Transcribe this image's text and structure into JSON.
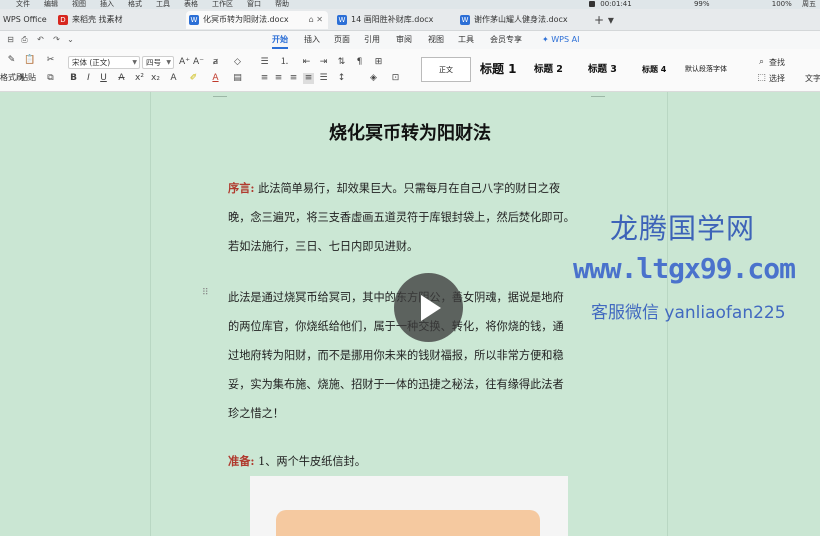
{
  "menubar": {
    "items": [
      "文件",
      "编辑",
      "视图",
      "插入",
      "格式",
      "工具",
      "表格",
      "工作区",
      "窗口",
      "帮助"
    ],
    "timer": "00:01:41",
    "battery": "99%",
    "battery2": "100%",
    "right_text": "周五"
  },
  "tabs": {
    "items": [
      {
        "label": "WPS Office",
        "badge_color": "#d7261e",
        "badge": ""
      },
      {
        "label": "来稻壳 找素材",
        "badge_color": "#d7261e",
        "badge": "D"
      },
      {
        "label": "化冥币转为阳财法.docx",
        "badge_color": "#2c6fd6",
        "badge": "W",
        "active": true
      },
      {
        "label": "14 画阳胜补财库.docx",
        "badge_color": "#2c6fd6",
        "badge": "W"
      },
      {
        "label": "谢作茅山耀人健身法.docx",
        "badge_color": "#2c6fd6",
        "badge": "W"
      }
    ],
    "new_tab": "+ ▾"
  },
  "ribbon": {
    "tabs": [
      "开始",
      "插入",
      "页面",
      "引用",
      "审阅",
      "视图",
      "工具",
      "会员专享"
    ],
    "ai": "WPS AI",
    "active": "开始"
  },
  "toolbar": {
    "format_painter": "格式刷",
    "paste": "粘贴",
    "font": "宋体 (正文)",
    "size": "四号",
    "styles": [
      "正文",
      "标题 1",
      "标题 2",
      "标题 3",
      "标题 4",
      "默认段落字体"
    ],
    "find": "查找",
    "select": "选择",
    "text_tool": "文字"
  },
  "doc": {
    "title": "烧化冥币转为阳财法",
    "preface_label": "序言:",
    "preface_lines": [
      "此法简单易行，却效果巨大。只需每月在自己八字的财日之夜",
      "晚，念三遍咒，将三支香虚画五道灵符于库银封袋上，然后焚化即可。",
      "若如法施行，三日、七日内即见进财。"
    ],
    "body_lines": [
      "此法是通过烧冥币给冥司，其中的东方阴公，善女阴魂，据说是地府",
      "的两位库官，你烧纸给他们，属于一种交换、转化，将你烧的钱，通",
      "过地府转为阳财，而不是挪用你未来的钱财福报，所以非常方便和稳",
      "妥，实为集布施、烧施、招财于一体的迅捷之秘法，往有缘得此法者",
      "珍之惜之！"
    ],
    "prep_label": "准备:",
    "prep_text": " 1、两个牛皮纸信封。"
  },
  "watermark": {
    "line1": "龙腾国学网",
    "line2": "www.ltgx99.com",
    "line3": "客服微信 yanliaofan225"
  }
}
